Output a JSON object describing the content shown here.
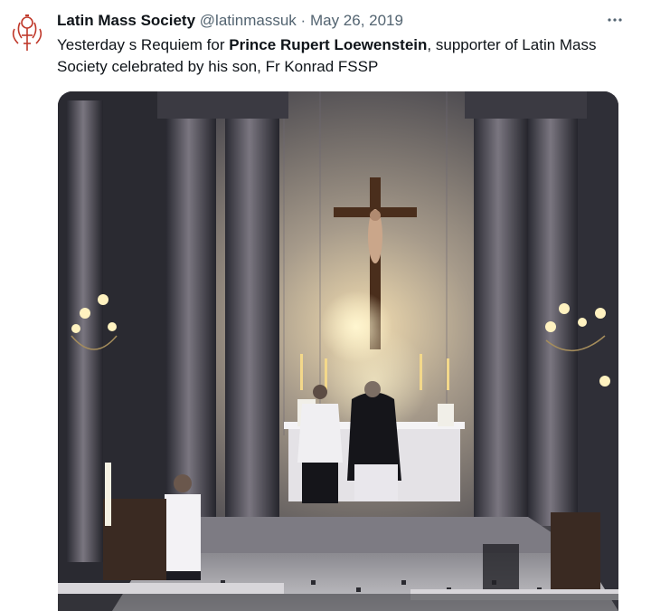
{
  "tweet": {
    "author_name": "Latin Mass Society",
    "handle": "@latinmassuk",
    "separator": "·",
    "date": "May 26, 2019",
    "more_icon": "ellipsis-icon",
    "text_part1": "Yesterday s Requiem for ",
    "text_bold": "Prince Rupert Loewenstein",
    "text_part2": ", supporter of Latin Mass Society celebrated by his son, Fr Konrad FSSP",
    "avatar_icon": "latin-mass-society-logo",
    "media_description_icon": "photo"
  },
  "colors": {
    "text": "#0f1419",
    "secondary": "#536471",
    "logo": "#c0392b"
  }
}
